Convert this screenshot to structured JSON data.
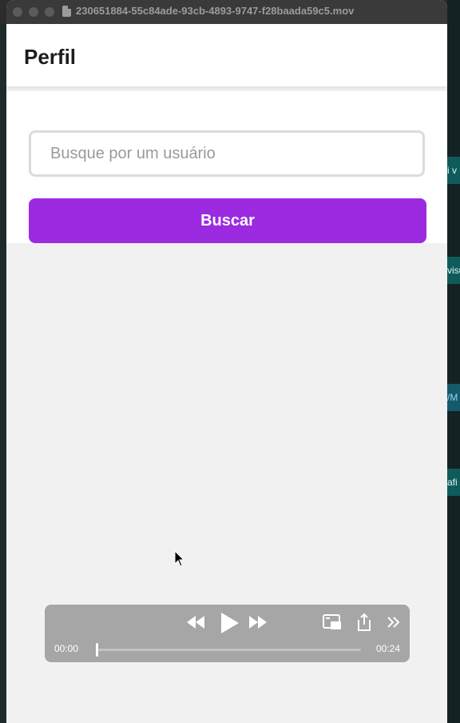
{
  "window": {
    "title": "230651884-55c84ade-93cb-4893-9747-f28baada59c5.mov"
  },
  "app": {
    "header_title": "Perfil",
    "search": {
      "placeholder": "Busque por um usuário",
      "value": ""
    },
    "search_button_label": "Buscar",
    "accent_color": "#9b2ae0"
  },
  "player": {
    "current_time": "00:00",
    "duration": "00:24",
    "progress": 0.0,
    "icons": [
      "rewind-icon",
      "play-icon",
      "fast-forward-icon",
      "picture-in-picture-icon",
      "share-icon",
      "more-icon"
    ]
  },
  "background": {
    "chips": [
      "i v",
      "visu",
      "/M",
      "afi"
    ]
  }
}
